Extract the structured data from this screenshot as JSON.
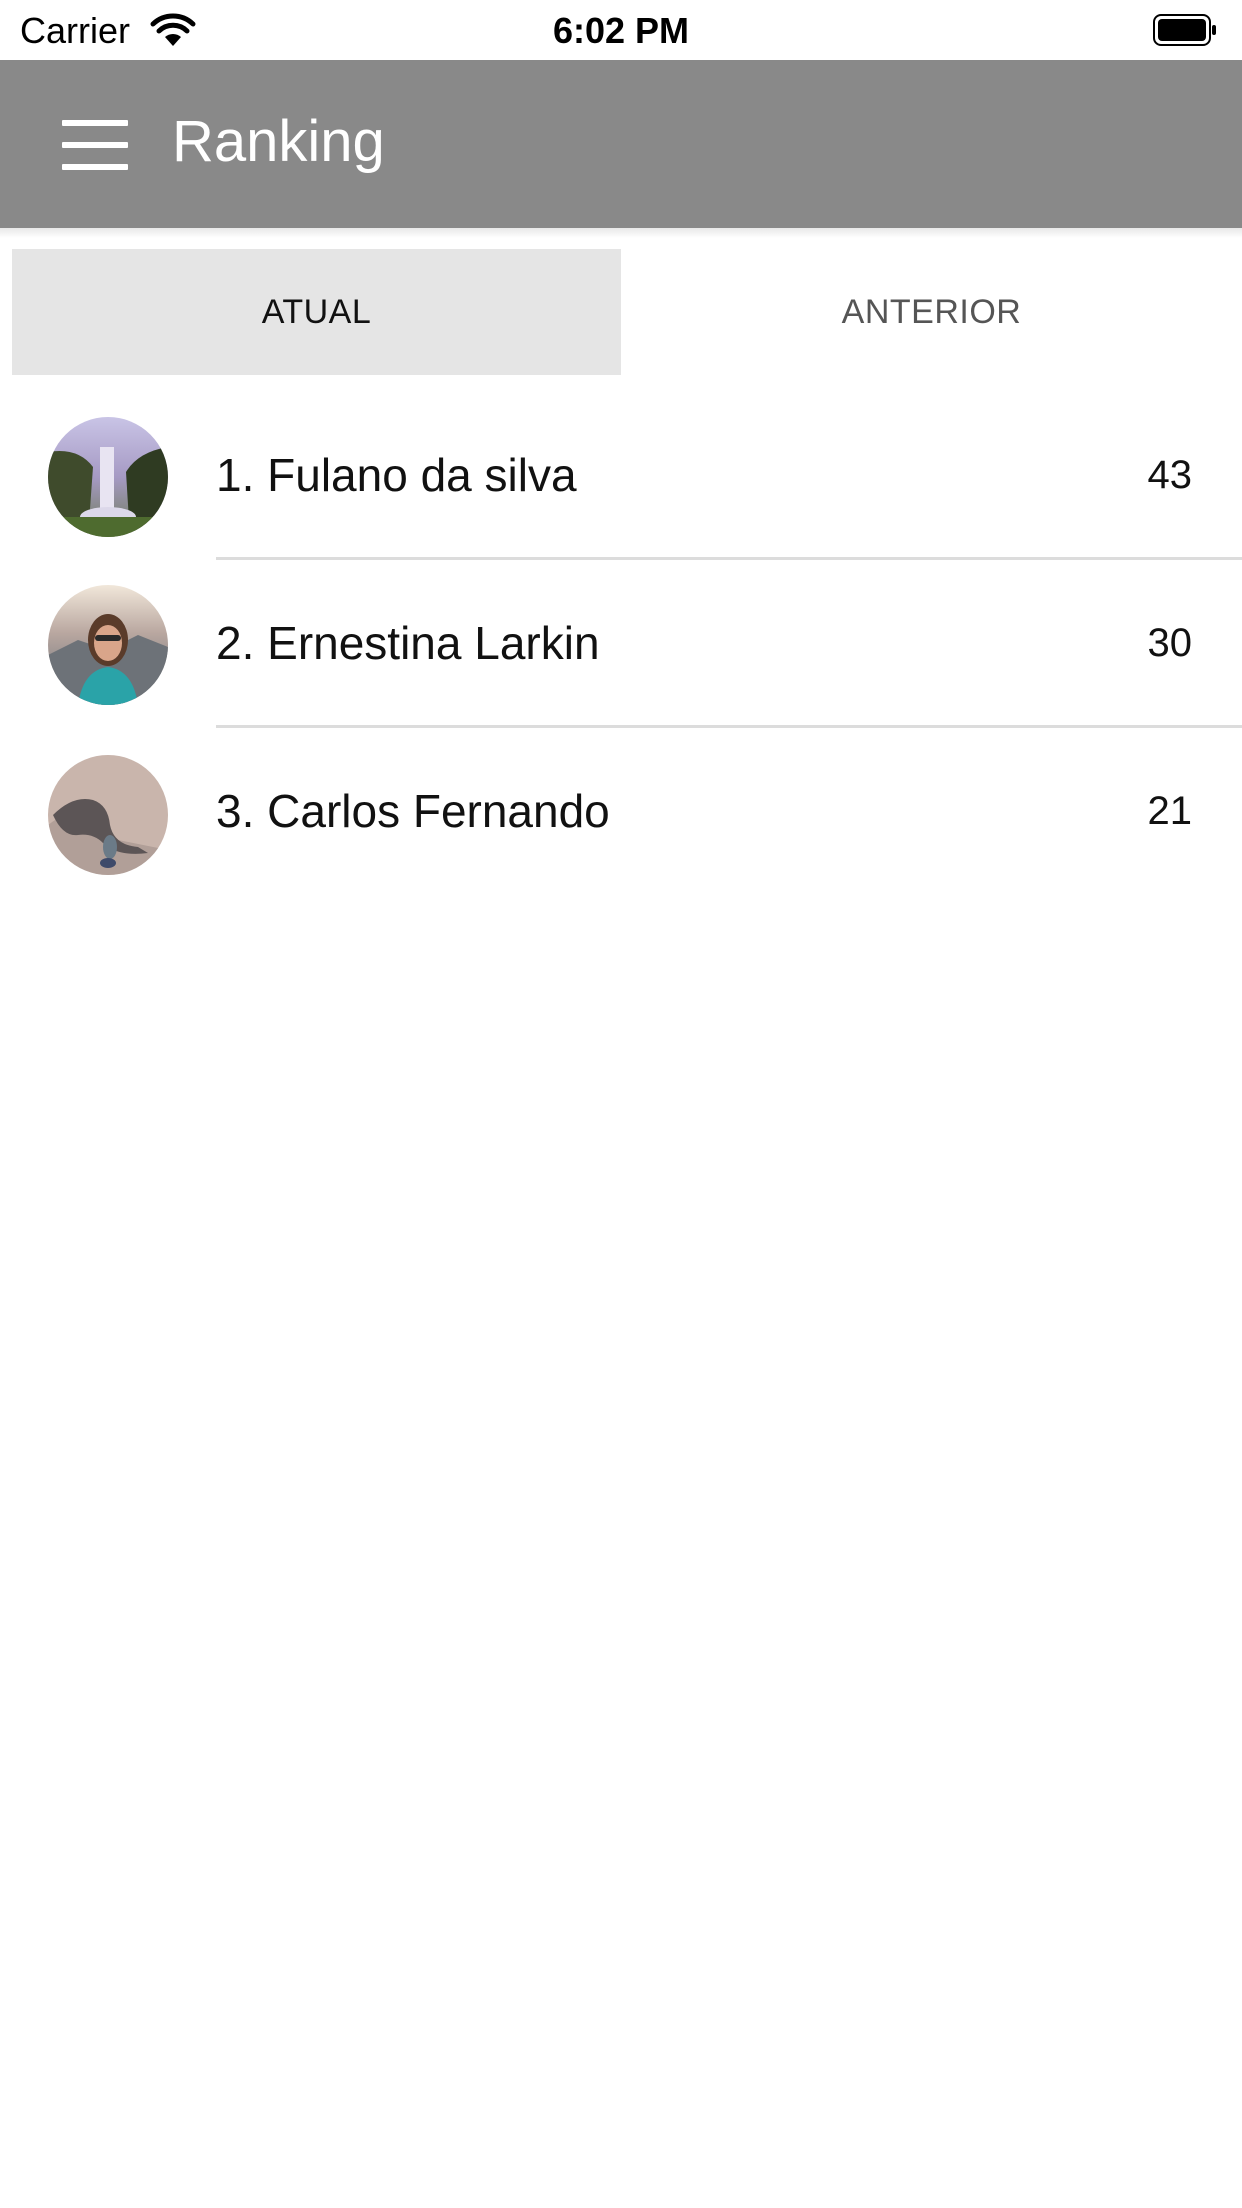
{
  "status_bar": {
    "carrier": "Carrier",
    "time": "6:02 PM"
  },
  "header": {
    "title": "Ranking",
    "menu_icon": "hamburger-menu-icon"
  },
  "tabs": [
    {
      "label": "ATUAL",
      "selected": true
    },
    {
      "label": "ANTERIOR",
      "selected": false
    }
  ],
  "ranking": [
    {
      "name": "1. Fulano da silva",
      "score": "43",
      "avatar": "waterfall-photo"
    },
    {
      "name": "2. Ernestina Larkin",
      "score": "30",
      "avatar": "woman-selfie-photo"
    },
    {
      "name": "3. Carlos Fernando",
      "score": "21",
      "avatar": "shadow-on-sand-photo"
    }
  ],
  "colors": {
    "app_bar": "#898989",
    "selected_tab": "#e5e5e5",
    "divider": "#dcdcdc"
  }
}
